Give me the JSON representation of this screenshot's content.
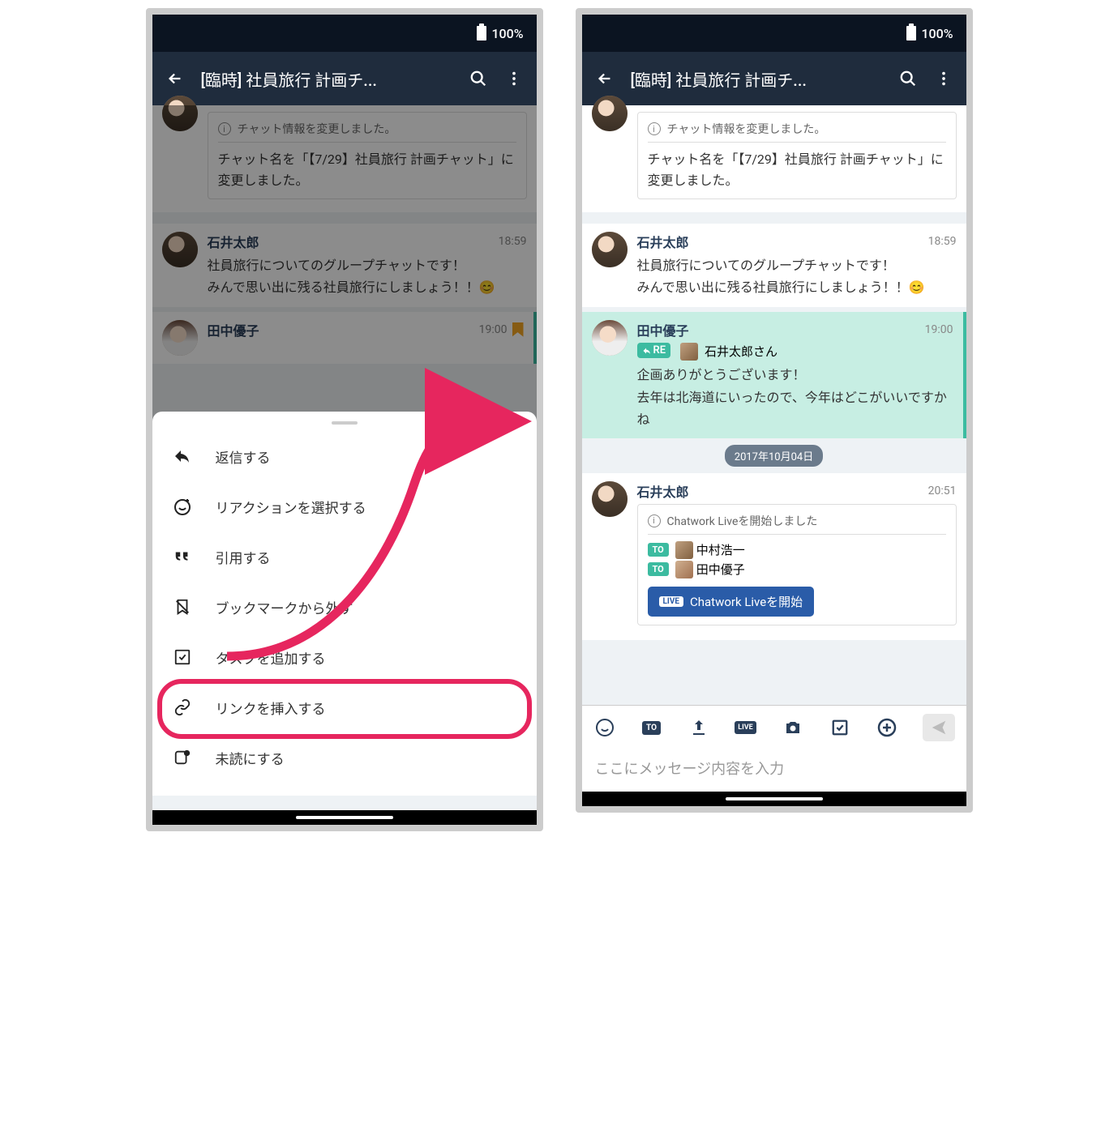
{
  "statusbar": {
    "battery": "100%"
  },
  "appbar": {
    "title": "[臨時] 社員旅行 計画チ..."
  },
  "system_notice": {
    "header": "チャット情報を変更しました。",
    "body": "チャット名を「【7/29】社員旅行 計画チャット」に変更しました。"
  },
  "messages": {
    "m1": {
      "name": "石井太郎",
      "time": "18:59",
      "text": "社員旅行についてのグループチャットです！\nみんで思い出に残る社員旅行にしましょう！！😊"
    },
    "m2": {
      "name": "田中優子",
      "time": "19:00",
      "reply_to": "石井太郎さん",
      "re_label": "RE",
      "text": "企画ありがとうございます！\n去年は北海道にいったので、今年はどこがいいですかね"
    },
    "date_sep": "2017年10月04日",
    "m3": {
      "name": "石井太郎",
      "time": "20:51",
      "live_header": "Chatwork Liveを開始しました",
      "to": [
        "中村浩一",
        "田中優子"
      ],
      "live_button": "Chatwork Liveを開始",
      "to_label": "TO",
      "live_badge": "LIVE"
    }
  },
  "sheet": {
    "reply": "返信する",
    "reaction": "リアクションを選択する",
    "quote": "引用する",
    "unbookmark": "ブックマークから外す",
    "task": "タスクを追加する",
    "link": "リンクを挿入する",
    "unread": "未読にする"
  },
  "input": {
    "placeholder": "ここにメッセージ内容を入力",
    "to_label": "TO",
    "live_label": "LIVE"
  }
}
